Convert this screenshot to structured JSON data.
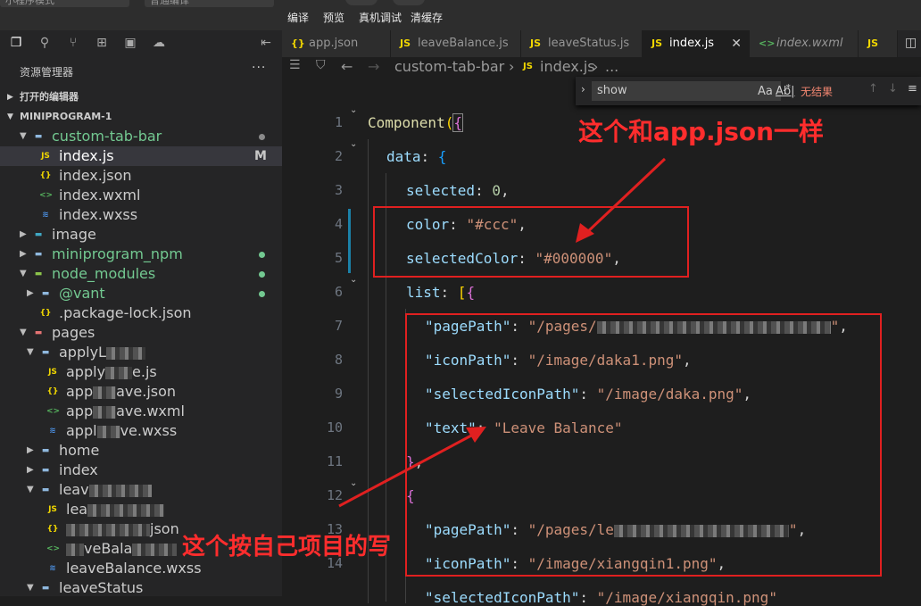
{
  "topbar": {
    "left_menu": "小程序模式",
    "mode": "普通编译",
    "actions": [
      "编译",
      "预览",
      "真机调试",
      "清缓存"
    ]
  },
  "explorer": {
    "title": "资源管理器",
    "more": "···",
    "open_editors": "打开的编辑器",
    "project": "MINIPROGRAM-1",
    "items": [
      {
        "label": "custom-tab-bar",
        "icon": "folder-open-icon"
      },
      {
        "label": "index.js",
        "icon": "js-icon",
        "mark": "M"
      },
      {
        "label": "index.json",
        "icon": "json-icon"
      },
      {
        "label": "index.wxml",
        "icon": "wxml-icon"
      },
      {
        "label": "index.wxss",
        "icon": "wxss-icon"
      },
      {
        "label": "image",
        "icon": "folder-icon"
      },
      {
        "label": "miniprogram_npm",
        "icon": "folder-icon"
      },
      {
        "label": "node_modules",
        "icon": "folder-open-icon"
      },
      {
        "label": "@vant",
        "icon": "folder-icon"
      },
      {
        "label": ".package-lock.json",
        "icon": "json-icon"
      },
      {
        "label": "pages",
        "icon": "folder-open-icon"
      },
      {
        "label": "applyL",
        "icon": "folder-open-icon"
      },
      {
        "label": "apply",
        "suffix": "e.js",
        "icon": "js-icon"
      },
      {
        "label": "app",
        "suffix": "ave.json",
        "icon": "json-icon"
      },
      {
        "label": "app",
        "suffix": "ave.wxml",
        "icon": "wxml-icon"
      },
      {
        "label": "appl",
        "suffix": "ve.wxss",
        "icon": "wxss-icon"
      },
      {
        "label": "home",
        "icon": "folder-icon"
      },
      {
        "label": "index",
        "icon": "folder-icon"
      },
      {
        "label": "leav",
        "icon": "folder-open-icon"
      },
      {
        "label": "lea",
        "icon": "js-icon"
      },
      {
        "label": "",
        "suffix": "json",
        "icon": "json-icon"
      },
      {
        "label": "",
        "suffix": "veBala",
        "icon": "wxml-icon"
      },
      {
        "label": "leaveBalance.wxss",
        "icon": "wxss-icon"
      },
      {
        "label": "leaveStatus",
        "icon": "folder-open-icon"
      }
    ]
  },
  "tabs": [
    {
      "label": "app.json",
      "icon": "json-icon"
    },
    {
      "label": "leaveBalance.js",
      "icon": "js-icon"
    },
    {
      "label": "leaveStatus.js",
      "icon": "js-icon"
    },
    {
      "label": "index.js",
      "icon": "js-icon",
      "close": "✕"
    },
    {
      "label": "index.wxml",
      "icon": "wxml-icon"
    },
    {
      "label": "JS",
      "icon": "js-icon"
    }
  ],
  "breadcrumb": {
    "folder": "custom-tab-bar",
    "file": "index.js",
    "tail": "..."
  },
  "find": {
    "value": "show",
    "case": "Aa",
    "word": "Ab|",
    "regex": ".*",
    "result": "无结果"
  },
  "line_numbers": [
    "1",
    "2",
    "3",
    "4",
    "5",
    "6",
    "7",
    "8",
    "9",
    "10",
    "11",
    "12",
    "13",
    "14"
  ],
  "code": {
    "l1_fn": "Component",
    "l2_key": "data",
    "l3_key": "selected",
    "l3_val": "0",
    "l4_key": "color",
    "l4_val": "\"#ccc\"",
    "l5_key": "selectedColor",
    "l5_val": "\"#000000\"",
    "l6_key": "list",
    "l7_key": "\"pagePath\"",
    "l7_val": "\"/pages/",
    "l8_key": "\"iconPath\"",
    "l8_val": "\"/image/daka1.png\"",
    "l9_key": "\"selectedIconPath\"",
    "l9_val": "\"/image/daka.png\"",
    "l10_key": "\"text\"",
    "l10_val": "\"Leave Balance\"",
    "l13_key": "\"pagePath\"",
    "l13_val": "\"/pages/le",
    "l14_key": "\"iconPath\"",
    "l14_val": "\"/image/xiangqin1.png\"",
    "l15_key": "\"selectedIconPath\"",
    "l15_val": "\"/image/xiangqin.png\""
  },
  "annotations": {
    "top": "这个和app.json一样",
    "bottom": "这个按自己项目的写"
  },
  "colors": {
    "annotation": "#ff2d2d",
    "editor_bg": "#1e1e1e",
    "sidebar_bg": "#252526"
  }
}
